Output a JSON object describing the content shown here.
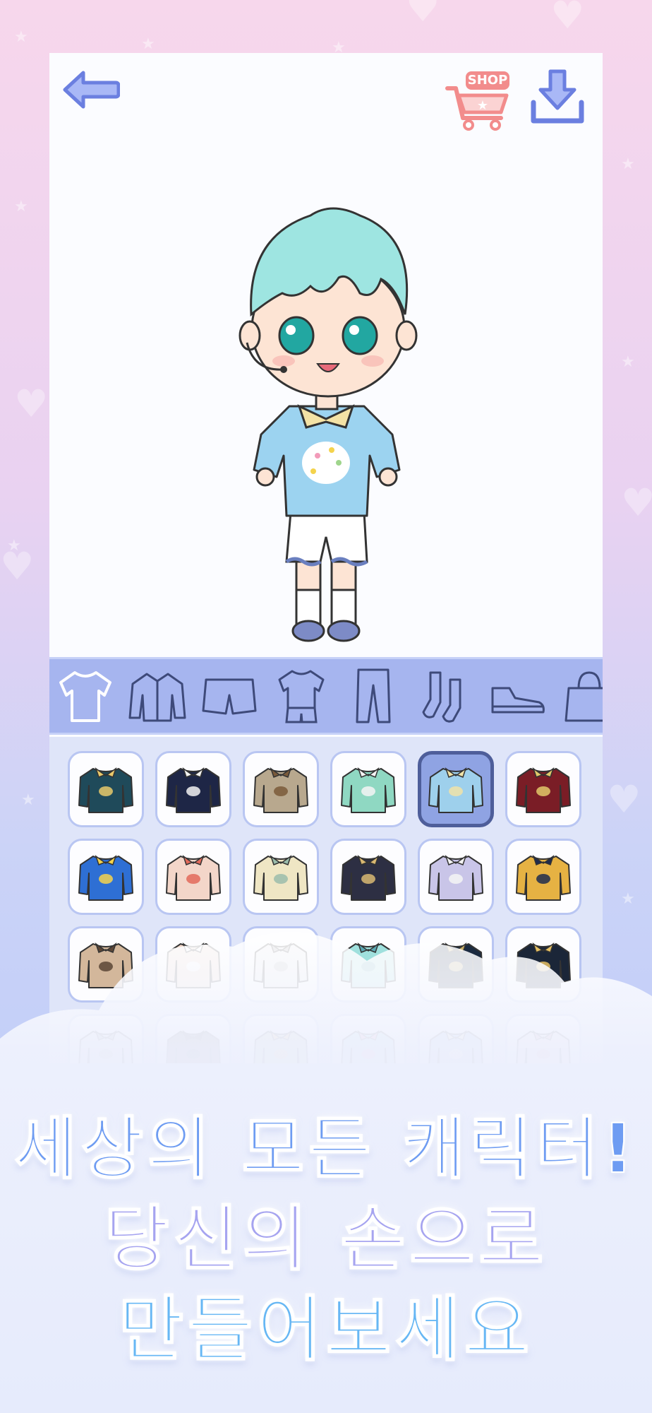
{
  "toolbar": {
    "back_icon": "arrow-left-icon",
    "shop_label": "SHOP",
    "shop_icon": "shopping-cart-icon",
    "download_icon": "download-icon"
  },
  "categories": [
    {
      "name": "tshirt",
      "icon": "tshirt-icon",
      "selected": true
    },
    {
      "name": "jacket",
      "icon": "jacket-icon",
      "selected": false
    },
    {
      "name": "shorts",
      "icon": "shorts-icon",
      "selected": false
    },
    {
      "name": "outfit-set",
      "icon": "outfit-set-icon",
      "selected": false
    },
    {
      "name": "pants",
      "icon": "pants-icon",
      "selected": false
    },
    {
      "name": "socks",
      "icon": "socks-icon",
      "selected": false
    },
    {
      "name": "shoes",
      "icon": "shoes-icon",
      "selected": false
    },
    {
      "name": "bag",
      "icon": "bag-icon",
      "selected": false
    }
  ],
  "items": [
    {
      "color": "#1f4a5a",
      "accent": "#e8c96b",
      "selected": false
    },
    {
      "color": "#1e2646",
      "accent": "#f2f2f2",
      "selected": false
    },
    {
      "color": "#b8a88e",
      "accent": "#7a5a3a",
      "selected": false
    },
    {
      "color": "#8fd8c2",
      "accent": "#f4f4f4",
      "selected": false
    },
    {
      "color": "#9ed0ec",
      "accent": "#f0e3a8",
      "selected": true
    },
    {
      "color": "#7a1d26",
      "accent": "#e2c86a",
      "selected": false
    },
    {
      "color": "#2e6fd4",
      "accent": "#f4d34c",
      "selected": false
    },
    {
      "color": "#f3d6c9",
      "accent": "#e26a5a",
      "selected": false
    },
    {
      "color": "#efe6c4",
      "accent": "#9bbcab",
      "selected": false
    },
    {
      "color": "#2d2f43",
      "accent": "#d9b872",
      "selected": false
    },
    {
      "color": "#c9c5e8",
      "accent": "#f4f4f4",
      "selected": false
    },
    {
      "color": "#e6b243",
      "accent": "#1f2b4e",
      "selected": false
    },
    {
      "color": "#d3b79b",
      "accent": "#5b4636",
      "selected": false
    },
    {
      "color": "#f1d6c8",
      "accent": "#ffffff",
      "selected": false
    },
    {
      "color": "#e8e8e8",
      "accent": "#aaaaaa",
      "selected": false
    },
    {
      "color": "#9fe0dd",
      "accent": "#5aa7b2",
      "selected": false
    },
    {
      "color": "#1a2a40",
      "accent": "#c9b06a",
      "selected": false
    },
    {
      "color": "#1b2638",
      "accent": "#e5c063",
      "selected": false
    },
    {
      "color": "#d9d9d9",
      "accent": "#9a9a9a",
      "selected": false
    },
    {
      "color": "#5a5a5a",
      "accent": "#2f2f2f",
      "selected": false
    },
    {
      "color": "#b7c6a2",
      "accent": "#e3b657",
      "selected": false
    },
    {
      "color": "#9ed4ea",
      "accent": "#f08bb0",
      "selected": false
    },
    {
      "color": "#9cb8e6",
      "accent": "#f1eac2",
      "selected": false
    },
    {
      "color": "#f0d9de",
      "accent": "#d6909f",
      "selected": false
    }
  ],
  "headline": {
    "line1": "세상의 모든 캐릭터!",
    "line2": "당신의 손으로",
    "line3": "만들어보세요"
  }
}
